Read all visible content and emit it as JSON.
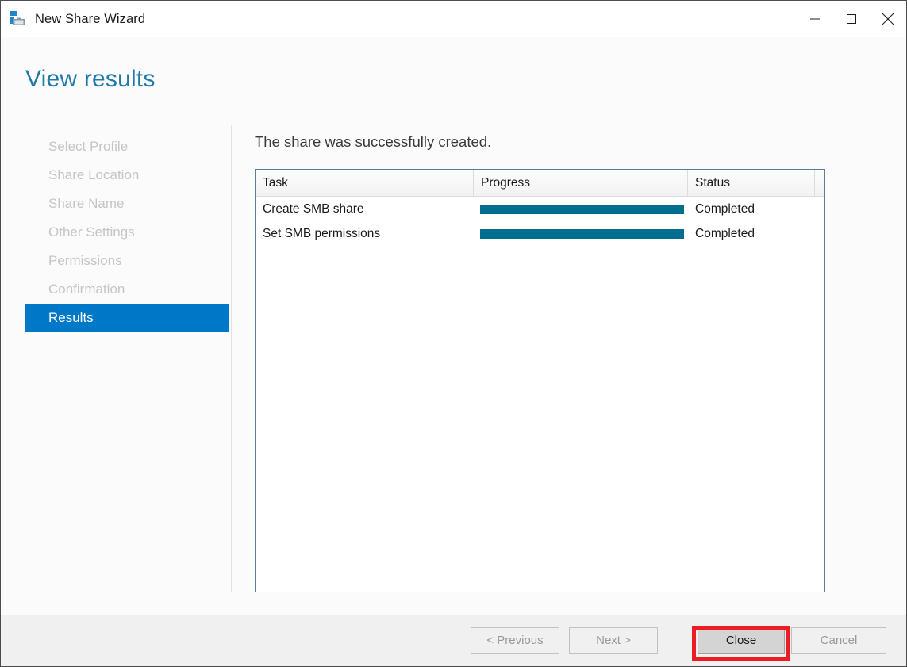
{
  "window": {
    "title": "New Share Wizard",
    "icon": "share-wizard-icon",
    "controls": {
      "minimize": "minimize-icon",
      "maximize": "maximize-icon",
      "close": "close-icon"
    }
  },
  "header": {
    "page_title": "View results",
    "accent_color": "#2079a8"
  },
  "sidebar": {
    "items": [
      {
        "label": "Select Profile",
        "active": false
      },
      {
        "label": "Share Location",
        "active": false
      },
      {
        "label": "Share Name",
        "active": false
      },
      {
        "label": "Other Settings",
        "active": false
      },
      {
        "label": "Permissions",
        "active": false
      },
      {
        "label": "Confirmation",
        "active": false
      },
      {
        "label": "Results",
        "active": true
      }
    ],
    "active_background": "#0078c8",
    "inactive_color": "#c5c5c5"
  },
  "main": {
    "heading": "The share was successfully created.",
    "table": {
      "columns": [
        "Task",
        "Progress",
        "Status"
      ],
      "rows": [
        {
          "task": "Create SMB share",
          "progress": 100,
          "status": "Completed"
        },
        {
          "task": "Set SMB permissions",
          "progress": 100,
          "status": "Completed"
        }
      ],
      "progress_color": "#006e8e",
      "border_color": "#5b7d9e"
    }
  },
  "footer": {
    "buttons": [
      {
        "id": "previous",
        "label": "< Previous",
        "enabled": false
      },
      {
        "id": "next",
        "label": "Next >",
        "enabled": false
      },
      {
        "id": "close",
        "label": "Close",
        "enabled": true
      },
      {
        "id": "cancel",
        "label": "Cancel",
        "enabled": false
      }
    ]
  },
  "annotation": {
    "target": "Close",
    "color": "#ec1c24"
  }
}
